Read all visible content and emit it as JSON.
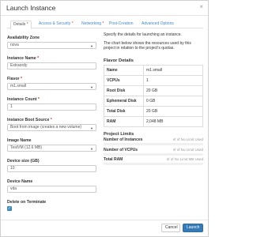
{
  "modal": {
    "title": "Launch Instance",
    "close_glyph": "×"
  },
  "tabs": [
    {
      "label": "Details",
      "required": "*",
      "active": true
    },
    {
      "label": "Access & Security",
      "required": "*",
      "active": false
    },
    {
      "label": "Networking",
      "required": "*",
      "active": false
    },
    {
      "label": "Post-Creation",
      "required": "",
      "active": false
    },
    {
      "label": "Advanced Options",
      "required": "",
      "active": false
    }
  ],
  "form": {
    "availability_zone": {
      "label": "Availability Zone",
      "value": "nova"
    },
    "instance_name": {
      "label": "Instance Name",
      "required": "*",
      "value": "Extraordy"
    },
    "flavor": {
      "label": "Flavor",
      "required": "*",
      "value": "m1.small"
    },
    "instance_count": {
      "label": "Instance Count",
      "required": "*",
      "value": "1"
    },
    "boot_source": {
      "label": "Instance Boot Source",
      "required": "*",
      "value": "Boot from image (creates a new volume)"
    },
    "image_name": {
      "label": "Image Name",
      "value": "TestVM (12.6 MB)"
    },
    "device_size": {
      "label": "Device size (GB)",
      "value": "10"
    },
    "device_name": {
      "label": "Device Name",
      "value": "vda"
    },
    "delete_on_terminate": {
      "label": "Delete on Terminate",
      "checked": true,
      "check_glyph": "✓"
    }
  },
  "info": {
    "desc1": "Specify the details for launching an instance.",
    "desc2": "The chart below shows the resources used by this project in relation to the project's quotas.",
    "flavor_details_title": "Flavor Details",
    "flavor_rows": [
      {
        "key": "Name",
        "value": "m1.small"
      },
      {
        "key": "VCPUs",
        "value": "1"
      },
      {
        "key": "Root Disk",
        "value": "20 GB"
      },
      {
        "key": "Ephemeral Disk",
        "value": "0 GB"
      },
      {
        "key": "Total Disk",
        "value": "20 GB"
      },
      {
        "key": "RAM",
        "value": "2,048 MB"
      }
    ],
    "project_limits_title": "Project Limits",
    "limits": [
      {
        "key": "Number of Instances",
        "value": "nf of No Limit Used"
      },
      {
        "key": "Number of VCPUs",
        "value": "nf of No Limit Used"
      },
      {
        "key": "Total RAM",
        "value": "nf of No Limit MB Used"
      }
    ]
  },
  "footer": {
    "cancel_label": "Cancel",
    "launch_label": "Launch"
  }
}
